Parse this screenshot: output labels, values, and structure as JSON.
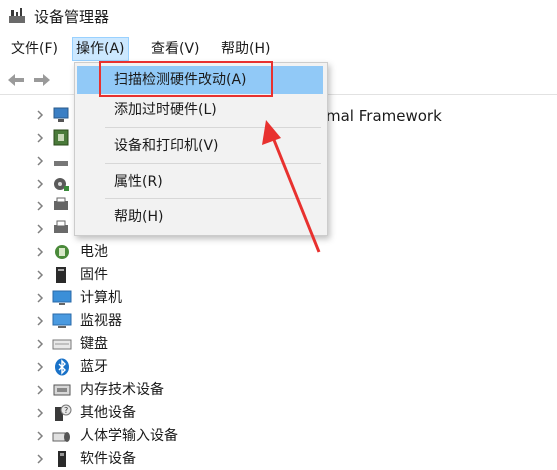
{
  "window": {
    "title": "设备管理器",
    "icon": "device-manager-icon"
  },
  "menubar": [
    {
      "label": "文件(F)"
    },
    {
      "label": "操作(A)"
    },
    {
      "label": "查看(V)"
    },
    {
      "label": "帮助(H)"
    }
  ],
  "toolbar": {
    "back_icon": "back-arrow-icon",
    "forward_icon": "forward-arrow-icon"
  },
  "dropdown": {
    "items": [
      {
        "label": "扫描检测硬件改动(A)"
      },
      {
        "label": "添加过时硬件(L)"
      },
      {
        "label": "设备和打印机(V)"
      },
      {
        "label": "属性(R)"
      },
      {
        "label": "帮助(H)"
      }
    ],
    "highlighted_index": 0
  },
  "tree": {
    "partial_text": "mal Framework",
    "items": [
      {
        "label": "",
        "icon": "computer-icon"
      },
      {
        "label": "",
        "icon": "chip-icon"
      },
      {
        "label": "",
        "icon": "disk-drive-icon"
      },
      {
        "label": "",
        "icon": "controller-icon"
      },
      {
        "label": "",
        "icon": "printer-queue-icon"
      },
      {
        "label": "",
        "icon": "printer-icon"
      },
      {
        "label": "电池",
        "icon": "battery-icon"
      },
      {
        "label": "固件",
        "icon": "firmware-icon"
      },
      {
        "label": "计算机",
        "icon": "computer-monitor-icon"
      },
      {
        "label": "监视器",
        "icon": "monitor-icon"
      },
      {
        "label": "键盘",
        "icon": "keyboard-icon"
      },
      {
        "label": "蓝牙",
        "icon": "bluetooth-icon"
      },
      {
        "label": "内存技术设备",
        "icon": "memory-icon"
      },
      {
        "label": "其他设备",
        "icon": "unknown-device-icon"
      },
      {
        "label": "人体学输入设备",
        "icon": "hid-icon"
      },
      {
        "label": "软件设备",
        "icon": "software-device-icon"
      }
    ]
  },
  "colors": {
    "menu_highlight": "#91c9f7",
    "annotation_red": "#e8312f",
    "active_menu": "#cce8ff"
  }
}
